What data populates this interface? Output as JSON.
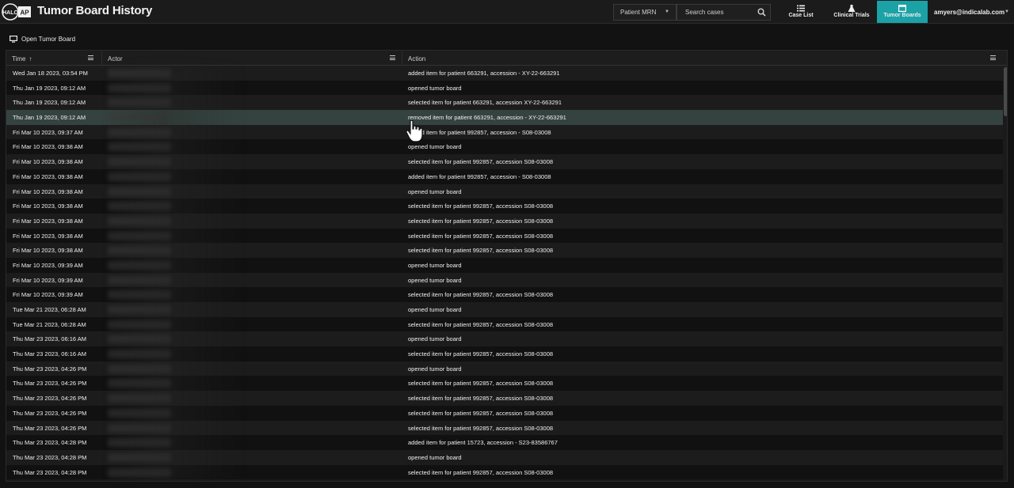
{
  "app": {
    "title": "Tumor Board History"
  },
  "topbar": {
    "mrn_select_label": "Patient MRN",
    "search_placeholder": "Search cases",
    "nav": [
      {
        "label": "Case List",
        "icon": "list-icon"
      },
      {
        "label": "Clinical Trials",
        "icon": "flask-icon"
      },
      {
        "label": "Tumor Boards",
        "icon": "window-icon",
        "active": true
      }
    ],
    "user": "amyers@indicalab.com",
    "accent_color": "#1aa2a6"
  },
  "toolbar": {
    "open_tumor_board_label": "Open Tumor Board"
  },
  "grid": {
    "columns": {
      "time": "Time",
      "actor": "Actor",
      "action": "Action"
    },
    "sort_indicator": "↑",
    "rows": [
      {
        "time": "Wed Jan 18 2023, 03:54 PM",
        "action": "added item for patient 663291, accession - XY-22-663291"
      },
      {
        "time": "Thu Jan 19 2023, 09:12 AM",
        "action": "opened tumor board"
      },
      {
        "time": "Thu Jan 19 2023, 09:12 AM",
        "action": "selected item for patient 663291, accession XY-22-663291"
      },
      {
        "time": "Thu Jan 19 2023, 09:12 AM",
        "action": "removed item for patient 663291, accession - XY-22-663291"
      },
      {
        "time": "Fri Mar 10 2023, 09:37 AM",
        "action": "added item for patient 992857, accession - S08-03008"
      },
      {
        "time": "Fri Mar 10 2023, 09:38 AM",
        "action": "opened tumor board"
      },
      {
        "time": "Fri Mar 10 2023, 09:38 AM",
        "action": "selected item for patient 992857, accession S08-03008"
      },
      {
        "time": "Fri Mar 10 2023, 09:38 AM",
        "action": "added item for patient 992857, accession - S08-03008"
      },
      {
        "time": "Fri Mar 10 2023, 09:38 AM",
        "action": "opened tumor board"
      },
      {
        "time": "Fri Mar 10 2023, 09:38 AM",
        "action": "selected item for patient 992857, accession S08-03008"
      },
      {
        "time": "Fri Mar 10 2023, 09:38 AM",
        "action": "selected item for patient 992857, accession S08-03008"
      },
      {
        "time": "Fri Mar 10 2023, 09:38 AM",
        "action": "selected item for patient 992857, accession S08-03008"
      },
      {
        "time": "Fri Mar 10 2023, 09:38 AM",
        "action": "selected item for patient 992857, accession S08-03008"
      },
      {
        "time": "Fri Mar 10 2023, 09:39 AM",
        "action": "opened tumor board"
      },
      {
        "time": "Fri Mar 10 2023, 09:39 AM",
        "action": "opened tumor board"
      },
      {
        "time": "Fri Mar 10 2023, 09:39 AM",
        "action": "selected item for patient 992857, accession S08-03008"
      },
      {
        "time": "Tue Mar 21 2023, 06:28 AM",
        "action": "opened tumor board"
      },
      {
        "time": "Tue Mar 21 2023, 06:28 AM",
        "action": "selected item for patient 992857, accession S08-03008"
      },
      {
        "time": "Thu Mar 23 2023, 06:16 AM",
        "action": "opened tumor board"
      },
      {
        "time": "Thu Mar 23 2023, 06:16 AM",
        "action": "selected item for patient 992857, accession S08-03008"
      },
      {
        "time": "Thu Mar 23 2023, 04:26 PM",
        "action": "opened tumor board"
      },
      {
        "time": "Thu Mar 23 2023, 04:26 PM",
        "action": "selected item for patient 992857, accession S08-03008"
      },
      {
        "time": "Thu Mar 23 2023, 04:26 PM",
        "action": "selected item for patient 992857, accession S08-03008"
      },
      {
        "time": "Thu Mar 23 2023, 04:26 PM",
        "action": "selected item for patient 992857, accession S08-03008"
      },
      {
        "time": "Thu Mar 23 2023, 04:26 PM",
        "action": "selected item for patient 992857, accession S08-03008"
      },
      {
        "time": "Thu Mar 23 2023, 04:28 PM",
        "action": "added item for patient 15723, accession - S23-83586767"
      },
      {
        "time": "Thu Mar 23 2023, 04:28 PM",
        "action": "opened tumor board"
      },
      {
        "time": "Thu Mar 23 2023, 04:28 PM",
        "action": "selected item for patient 992857, accession S08-03008"
      }
    ],
    "hovered_row": 3
  }
}
